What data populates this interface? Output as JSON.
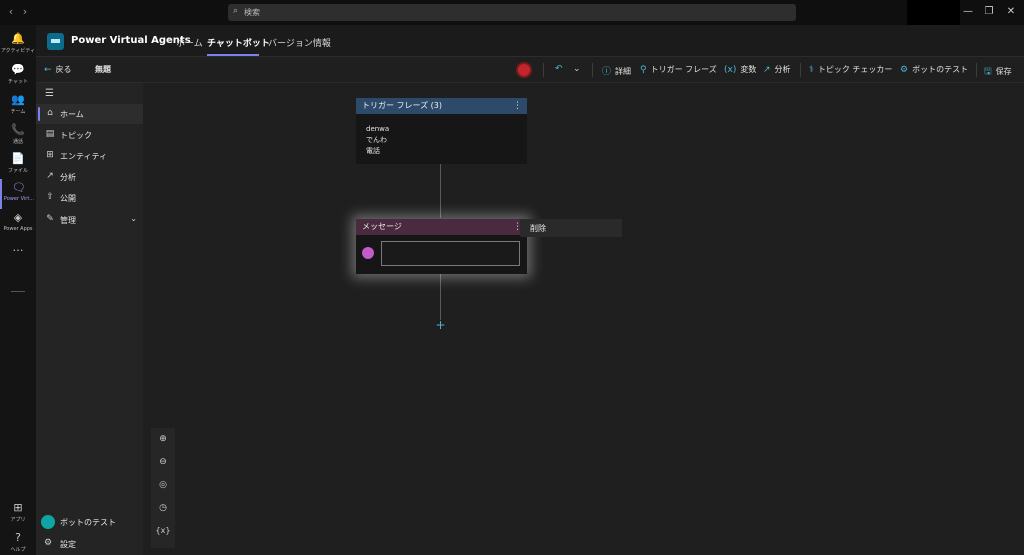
{
  "titlebar": {
    "back_glyph": "‹",
    "forward_glyph": "›",
    "search_placeholder": "検索",
    "minimize_glyph": "—",
    "maximize_glyph": "❐",
    "close_glyph": "✕"
  },
  "rail": {
    "items": [
      {
        "label": "アクティビティ",
        "icon": "bell-icon",
        "glyph": "🔔"
      },
      {
        "label": "チャット",
        "icon": "chat-icon",
        "glyph": "💬"
      },
      {
        "label": "チーム",
        "icon": "teams-icon",
        "glyph": "👥"
      },
      {
        "label": "通話",
        "icon": "phone-icon",
        "glyph": "📞"
      },
      {
        "label": "ファイル",
        "icon": "file-icon",
        "glyph": "📄"
      },
      {
        "label": "Power Virt...",
        "icon": "power-virtual-agents-icon",
        "glyph": "🗨"
      },
      {
        "label": "Power Apps",
        "icon": "power-apps-icon",
        "glyph": "◈"
      }
    ],
    "more_label": "…",
    "bottom": [
      {
        "label": "アプリ",
        "icon": "apps-icon",
        "glyph": "⊞"
      },
      {
        "label": "ヘルプ",
        "icon": "help-icon",
        "glyph": "?"
      }
    ]
  },
  "header": {
    "app_title": "Power Virtual Agents",
    "tabs": [
      {
        "label": "ホーム"
      },
      {
        "label": "チャットボット"
      },
      {
        "label": "バージョン情報"
      }
    ]
  },
  "commandbar": {
    "back_label": "戻る",
    "topic_name": "無題",
    "details_label": "詳細",
    "trigger_phrases_label": "トリガー フレーズ",
    "variables_label": "変数",
    "analytics_label": "分析",
    "topic_checker_label": "トピック チェッカー",
    "test_bot_label": "ボットのテスト",
    "save_label": "保存"
  },
  "leftnav": {
    "items": [
      {
        "label": "ホーム",
        "icon": "home-icon",
        "glyph": "⌂"
      },
      {
        "label": "トピック",
        "icon": "topic-icon",
        "glyph": "▤"
      },
      {
        "label": "エンティティ",
        "icon": "entity-icon",
        "glyph": "⊞"
      },
      {
        "label": "分析",
        "icon": "analytics-icon",
        "glyph": "↗"
      },
      {
        "label": "公開",
        "icon": "publish-icon",
        "glyph": "⇧"
      },
      {
        "label": "管理",
        "icon": "manage-icon",
        "glyph": "✎"
      }
    ],
    "test_bot_label": "ボットのテスト",
    "settings_label": "設定"
  },
  "canvas": {
    "trigger_node": {
      "title": "トリガー フレーズ (3)",
      "phrases": [
        "denwa",
        "でんわ",
        "電話"
      ]
    },
    "message_node": {
      "title": "メッセージ",
      "input_value": ""
    },
    "context_menu": {
      "delete_label": "削除"
    },
    "zoom": {
      "zoom_in": "⊕",
      "zoom_out": "⊖",
      "center": "◎",
      "history": "◷",
      "variables": "{x}"
    }
  },
  "colors": {
    "accent": "#7b83eb",
    "trigger_header": "#2d4a6b",
    "message_header": "#4a2a3f",
    "icon_blue": "#4fb3d9"
  }
}
